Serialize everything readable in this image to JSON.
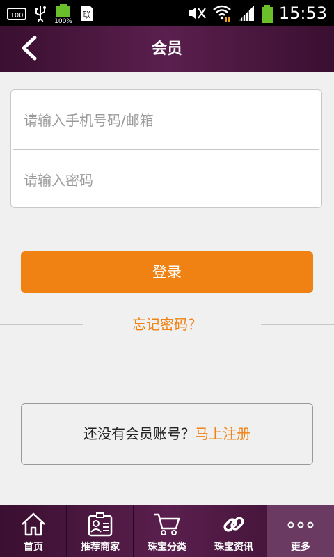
{
  "status_bar": {
    "time": "15:53",
    "battery_label": "100%",
    "left_icons": [
      "sms-100-icon",
      "usb-icon",
      "battery-100-icon",
      "sim-icon"
    ],
    "right_icons": [
      "mute-icon",
      "wifi-icon",
      "signal-icon",
      "battery-icon"
    ]
  },
  "header": {
    "title": "会员"
  },
  "login_form": {
    "account_placeholder": "请输入手机号码/邮箱",
    "password_placeholder": "请输入密码",
    "login_label": "登录",
    "forgot_label": "忘记密码？"
  },
  "register": {
    "prompt": "还没有会员账号？",
    "link_label": "马上注册"
  },
  "bottom_nav": {
    "items": [
      {
        "label": "首页",
        "icon": "home-icon"
      },
      {
        "label": "推荐商家",
        "icon": "merchant-card-icon"
      },
      {
        "label": "珠宝分类",
        "icon": "cart-icon"
      },
      {
        "label": "珠宝资讯",
        "icon": "link-icon"
      },
      {
        "label": "更多",
        "icon": "more-dots-icon"
      }
    ],
    "active_index": 4
  },
  "colors": {
    "accent": "#f08213",
    "header_bg": "#4a1740",
    "page_bg": "#f0f0f0"
  }
}
